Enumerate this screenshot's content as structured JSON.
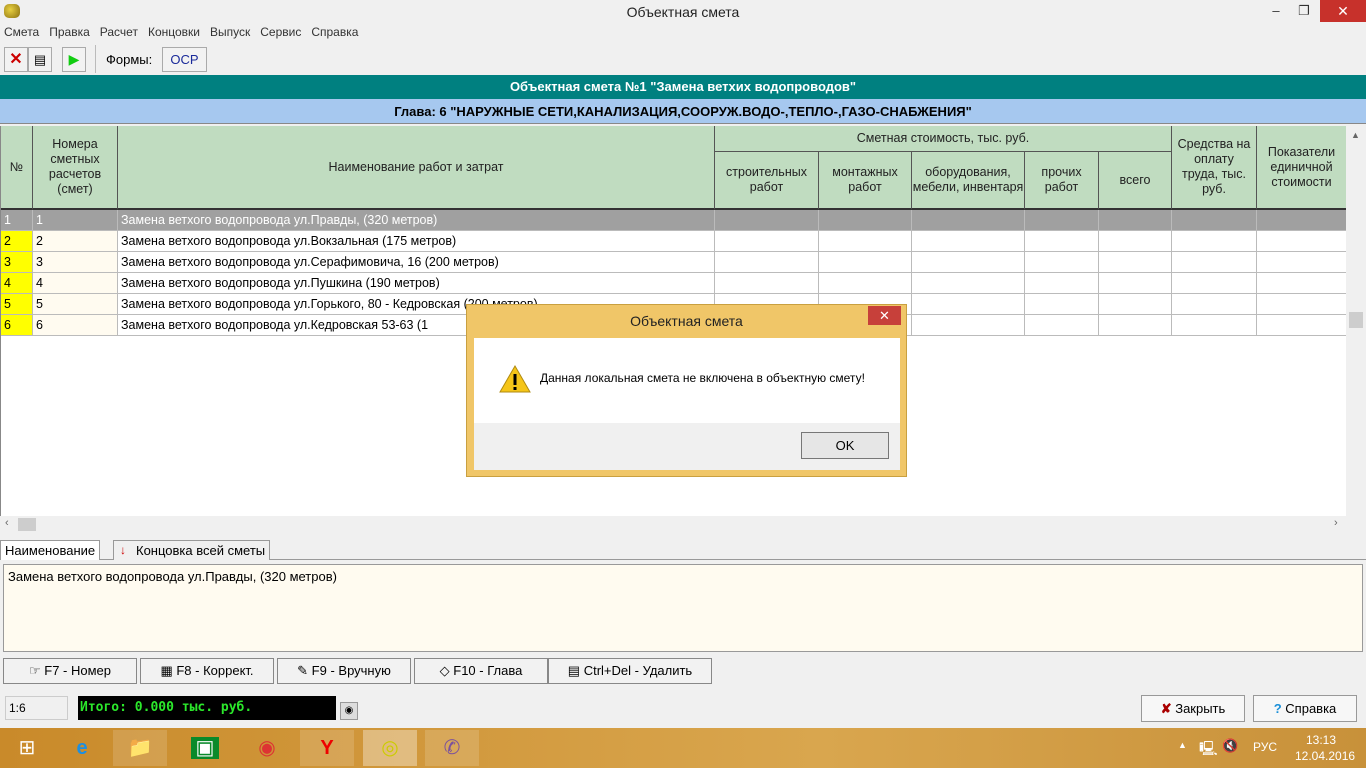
{
  "window": {
    "title": "Объектная смета",
    "minimize": "–",
    "maximize": "❐",
    "close": "✕"
  },
  "menu": [
    "Смета",
    "Правка",
    "Расчет",
    "Концовки",
    "Выпуск",
    "Сервис",
    "Справка"
  ],
  "toolbar": {
    "forms_label": "Формы:",
    "ocp_label": "ОСР"
  },
  "header": {
    "estimate_title": "Объектная смета №1 \"Замена ветхих водопроводов\"",
    "chapter_title": "Глава: 6 \"НАРУЖНЫЕ СЕТИ,КАНАЛИЗАЦИЯ,СООРУЖ.ВОДО-,ТЕПЛО-,ГАЗО-СНАБЖЕНИЯ\""
  },
  "table": {
    "columns": {
      "num": "№",
      "calc_numbers": "Номера сметных расчетов (смет)",
      "name": "Наименование работ и затрат",
      "cost_group": "Сметная стоимость, тыс. руб.",
      "construction": "строительных работ",
      "installation": "монтажных работ",
      "equipment": "оборудования, мебели, инвентаря",
      "other": "прочих работ",
      "total": "всего",
      "wages": "Средства на оплату труда, тыс. руб.",
      "unit_cost": "Показатели единичной стоимости"
    },
    "rows": [
      {
        "num": "1",
        "calc": "1",
        "name": "Замена ветхого водопровода ул.Правды, (320 метров)",
        "selected": true
      },
      {
        "num": "2",
        "calc": "2",
        "name": "Замена ветхого водопровода ул.Вокзальная (175 метров)"
      },
      {
        "num": "3",
        "calc": "3",
        "name": "Замена ветхого водопровода ул.Серафимовича, 16 (200 метров)"
      },
      {
        "num": "4",
        "calc": "4",
        "name": "Замена ветхого водопровода ул.Пушкина (190 метров)"
      },
      {
        "num": "5",
        "calc": "5",
        "name": "Замена ветхого водопровода ул.Горького, 80 - Кедровская (200 метров)"
      },
      {
        "num": "6",
        "calc": "6",
        "name": "Замена ветхого водопровода ул.Кедровская 53-63  (1"
      }
    ]
  },
  "tabs": [
    "Наименование",
    "Концовка всей сметы"
  ],
  "memo_text": "Замена ветхого водопровода ул.Правды, (320 метров)",
  "function_buttons": [
    "F7 - Номер",
    "F8 - Коррект.",
    "F9 - Вручную",
    "F10 - Глава",
    "Ctrl+Del - Удалить"
  ],
  "status": {
    "count": "1:6",
    "total": "Итого: 0.000 тыс. руб."
  },
  "bottom_buttons": {
    "close": "Закрыть",
    "help": "Справка"
  },
  "dialog": {
    "title": "Объектная смета",
    "message": "Данная локальная смета не включена в объектную смету!",
    "ok": "OK",
    "close": "✕"
  },
  "taskbar": {
    "lang": "РУС",
    "time": "13:13",
    "date": "12.04.2016"
  },
  "colors": {
    "teal": "#008080",
    "chapter_blue": "#a6c8ef",
    "header_green": "#c0dcc0",
    "row_num_yellow": "#ffff00",
    "total_green": "#2be82b"
  }
}
